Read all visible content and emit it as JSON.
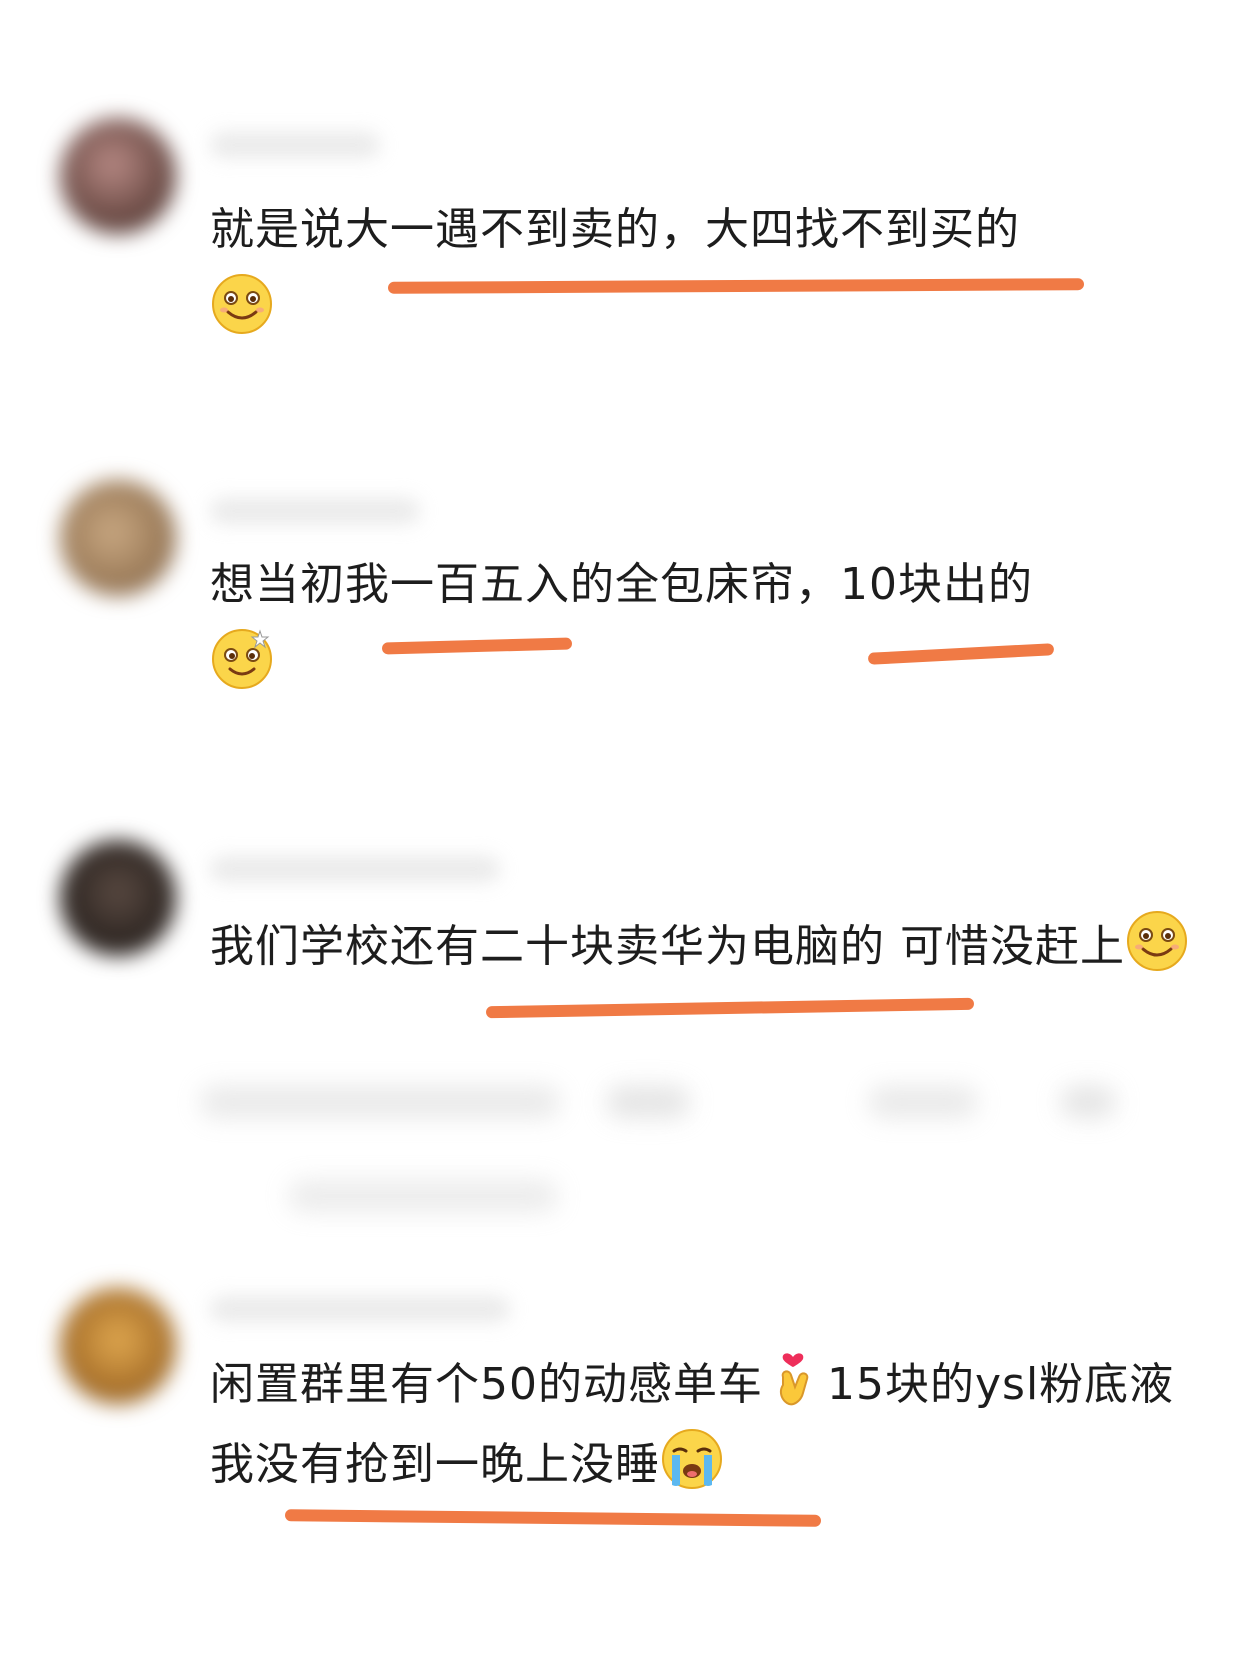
{
  "comments": [
    {
      "text": "就是说大一遇不到卖的，大四找不到买的"
    },
    {
      "text": "想当初我一百五入的全包床帘，10块出的"
    },
    {
      "text": "我们学校还有二十块卖华为电脑的 可惜没赶上"
    },
    {
      "text_part1": "闲置群里有个50的动感单车",
      "text_part2": "15块的ysl粉底液我没有抢到一晚上没睡"
    }
  ],
  "icons": {
    "smile": "smiling-face-emoji",
    "dizzy": "dizzy-face-emoji",
    "finger_heart": "finger-heart-emoji",
    "crying": "loudly-crying-emoji"
  },
  "colors": {
    "underline": "#f07a45",
    "text": "#1d1d1d",
    "background": "#ffffff"
  }
}
